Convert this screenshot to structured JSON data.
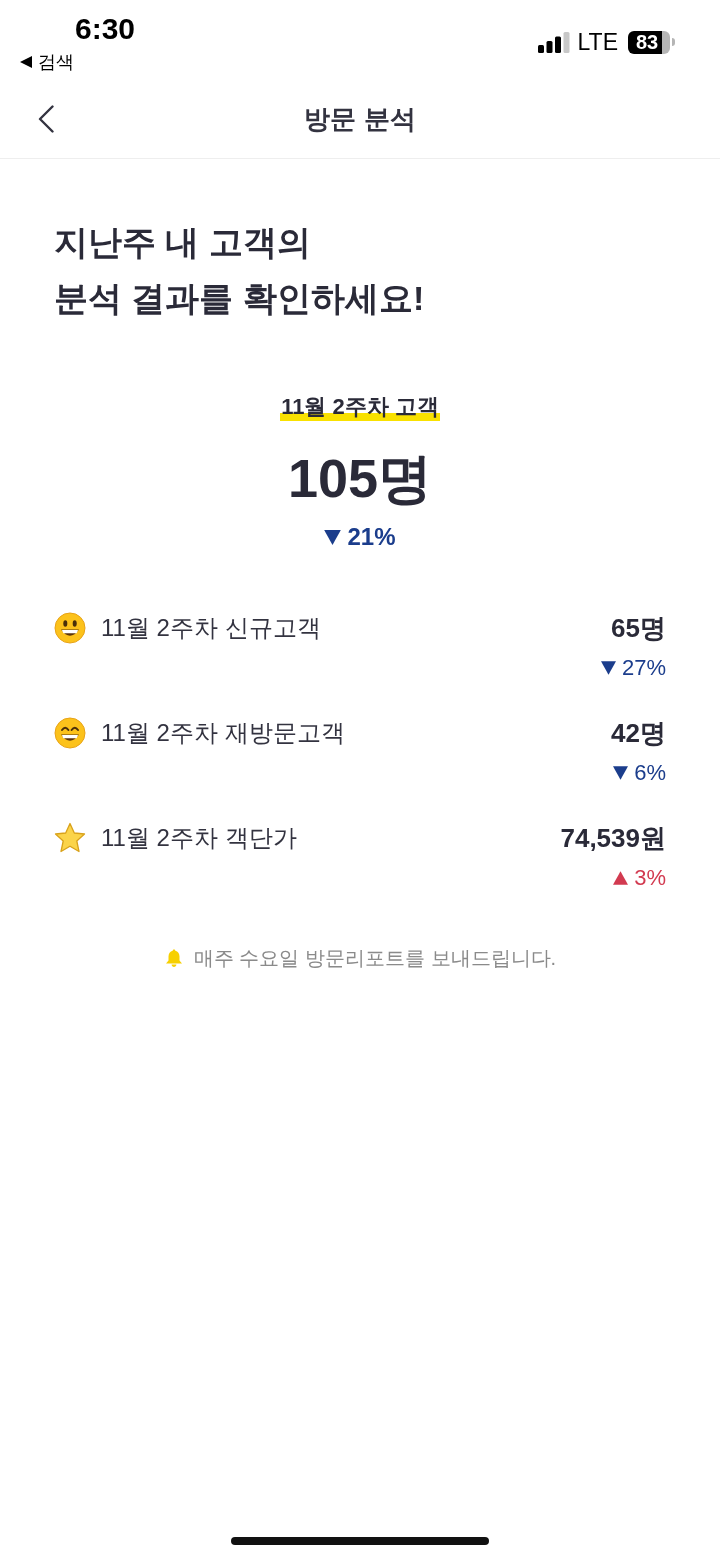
{
  "status_bar": {
    "time": "6:30",
    "back_app": "검색",
    "network": "LTE",
    "battery": "83"
  },
  "nav": {
    "title": "방문 분석"
  },
  "headline": "지난주 내 고객의\n분석 결과를 확인하세요!",
  "summary": {
    "label": "11월 2주차 고객",
    "value": "105명",
    "change": {
      "increase": false,
      "text": "21%"
    }
  },
  "metrics": [
    {
      "kind": "smile",
      "label": "11월 2주차 신규고객",
      "value": "65명",
      "change": {
        "increase": false,
        "text": "27%"
      }
    },
    {
      "kind": "grin",
      "label": "11월 2주차 재방문고객",
      "value": "42명",
      "change": {
        "increase": false,
        "text": "6%"
      }
    },
    {
      "kind": "star",
      "label": "11월 2주차 객단가",
      "value": "74,539원",
      "change": {
        "increase": true,
        "text": "3%"
      }
    }
  ],
  "footer_note": "매주 수요일 방문리포트를 보내드립니다."
}
